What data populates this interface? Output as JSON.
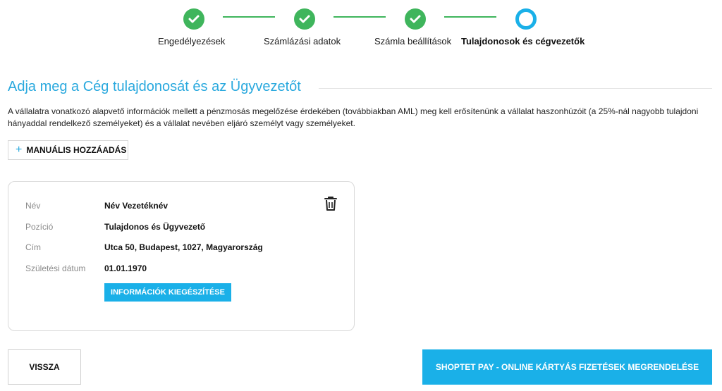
{
  "stepper": {
    "steps": [
      {
        "label": "Engedélyezések",
        "status": "done"
      },
      {
        "label": "Számlázási adatok",
        "status": "done"
      },
      {
        "label": "Számla beállítások",
        "status": "done"
      },
      {
        "label": "Tulajdonosok és cégvezetők",
        "status": "current"
      }
    ],
    "colors": {
      "done": "#3fb55c",
      "current": "#1ab0e8"
    }
  },
  "section": {
    "heading": "Adja meg a Cég tulajdonosát és az Ügyvezetőt",
    "intro": "A vállalatra vonatkozó alapvető információk mellett a pénzmosás megelőzése érdekében (továbbiakban AML) meg kell erősítenünk a vállalat haszonhúzóit (a 25%-nál nagyobb tulajdoni hányaddal rendelkező személyeket) és a vállalat nevében eljáró személyt vagy személyeket."
  },
  "add_manual_button": {
    "icon": "plus-icon",
    "label": "MANUÁLIS HOZZÁADÁS"
  },
  "owner_card": {
    "fields": [
      {
        "label": "Név",
        "value": "Név Vezetéknév"
      },
      {
        "label": "Pozíció",
        "value": "Tulajdonos és Ügyvezető"
      },
      {
        "label": "Cím",
        "value": "Utca 50, Budapest, 1027, Magyarország"
      },
      {
        "label": "Születési dátum",
        "value": "01.01.1970"
      }
    ],
    "delete_icon": "trash-icon",
    "complete_button": "INFORMÁCIÓK KIEGÉSZÍTÉSE"
  },
  "footer": {
    "back_button": "VISSZA",
    "order_button": "SHOPTET PAY - ONLINE KÁRTYÁS FIZETÉSEK MEGRENDELÉSE"
  },
  "accent_color": "#1ab0e8"
}
